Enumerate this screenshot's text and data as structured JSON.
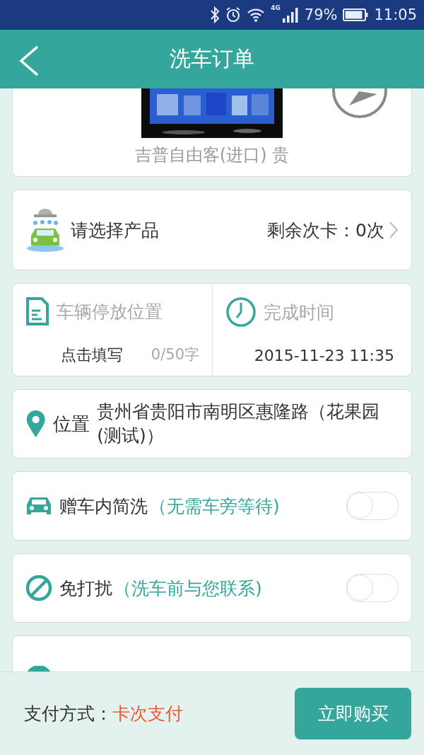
{
  "status_bar": {
    "network": "4G",
    "battery": "79%",
    "time": "11:05"
  },
  "header": {
    "title": "洗车订单"
  },
  "vehicle": {
    "name": "吉普自由客(进口) 贵"
  },
  "product": {
    "label": "请选择产品",
    "remaining": "剩余次卡：0次"
  },
  "parking": {
    "title": "车辆停放位置",
    "placeholder": "点击填写",
    "counter": "0/50字"
  },
  "finish_time": {
    "title": "完成时间",
    "value": "2015-11-23 11:35"
  },
  "location": {
    "label": "位置",
    "address": "贵州省贵阳市南明区惠隆路（花果园(测试)）"
  },
  "options": [
    {
      "kind": "car",
      "label": "赠车内简洗",
      "note": "（无需车旁等待)",
      "on": false
    },
    {
      "kind": "block",
      "label": "免打扰",
      "note": "（洗车前与您联系)",
      "on": false
    }
  ],
  "footer": {
    "label": "支付方式：",
    "value": "卡次支付",
    "button": "立即购买"
  }
}
